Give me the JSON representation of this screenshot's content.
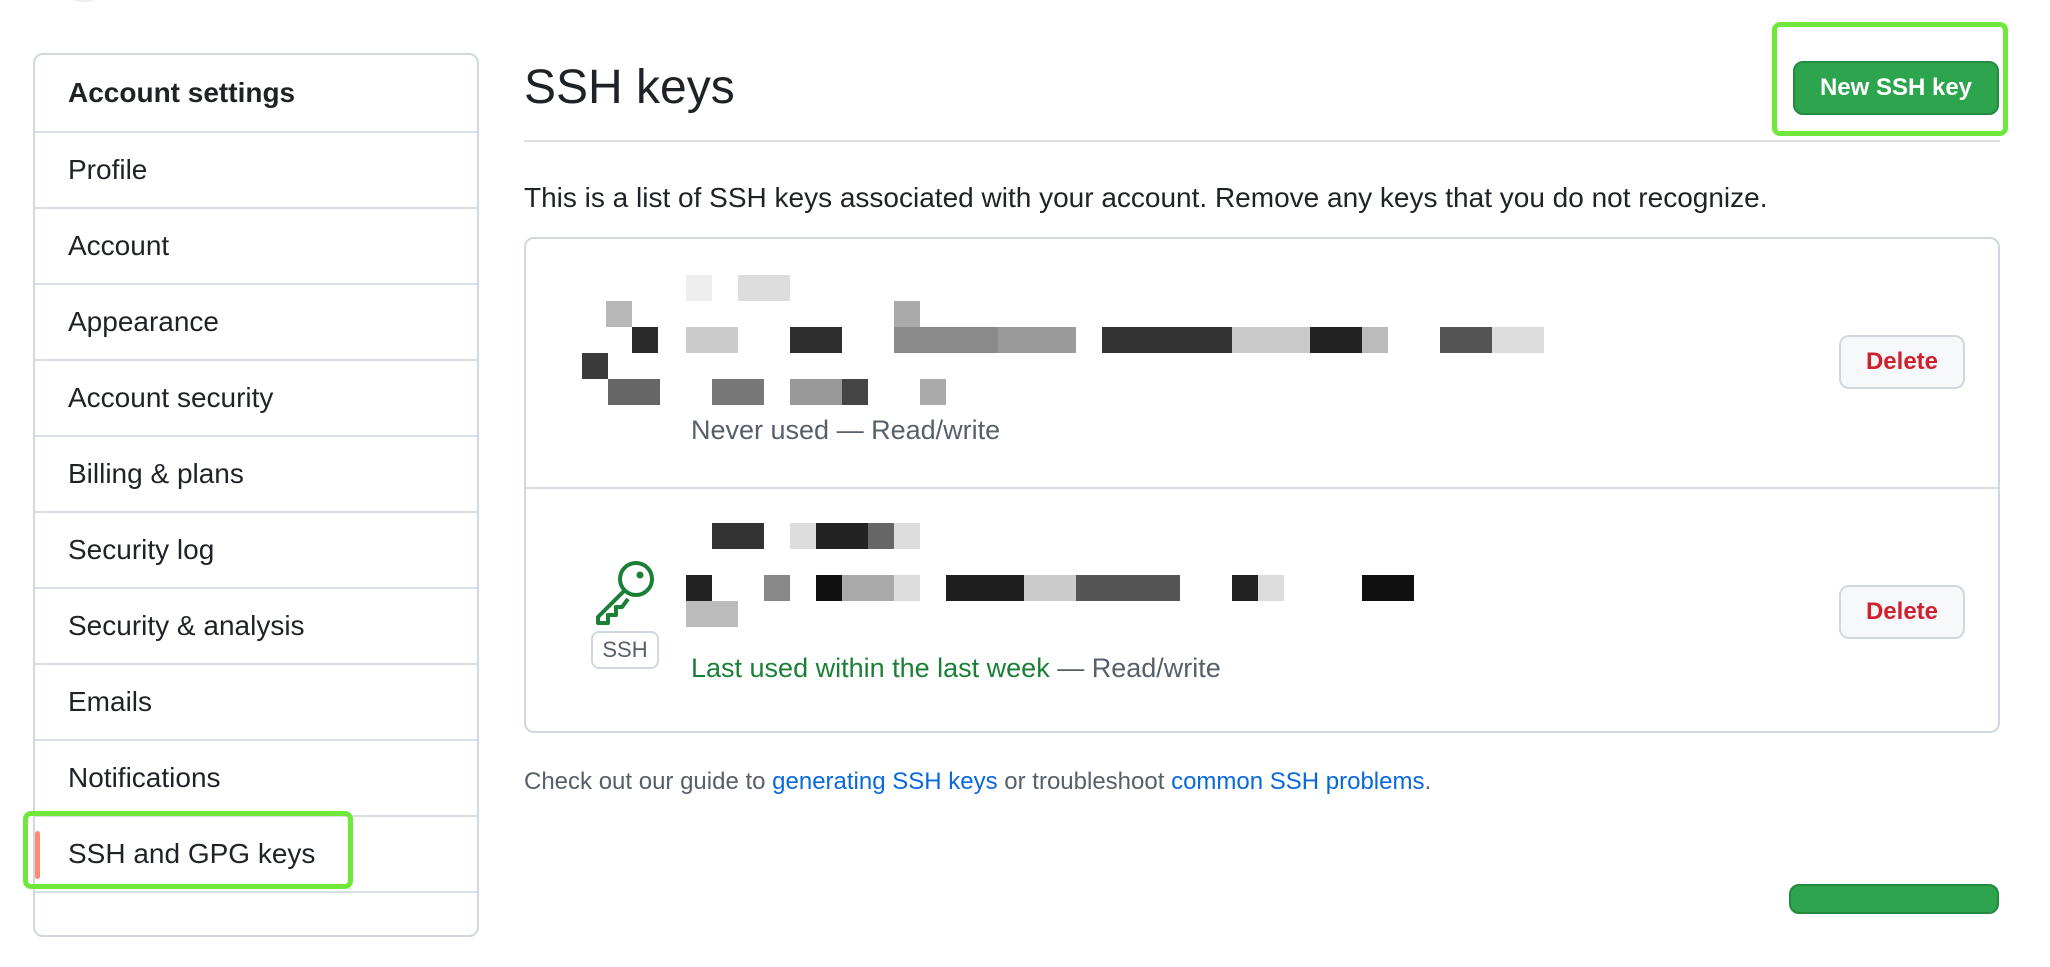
{
  "sidebar": {
    "header": "Account settings",
    "items": [
      {
        "label": "Profile"
      },
      {
        "label": "Account"
      },
      {
        "label": "Appearance"
      },
      {
        "label": "Account security"
      },
      {
        "label": "Billing & plans"
      },
      {
        "label": "Security log"
      },
      {
        "label": "Security & analysis"
      },
      {
        "label": "Emails"
      },
      {
        "label": "Notifications"
      },
      {
        "label": "SSH and GPG keys",
        "active": true
      }
    ]
  },
  "main": {
    "title": "SSH keys",
    "new_key_label": "New SSH key",
    "intro": "This is a list of SSH keys associated with your account. Remove any keys that you do not recognize.",
    "keys": [
      {
        "usage": "Never used",
        "access": "— Read/write",
        "delete_label": "Delete"
      },
      {
        "badge": "SSH",
        "usage": "Last used within the last week",
        "access": "— Read/write",
        "delete_label": "Delete"
      }
    ],
    "footer": {
      "prefix": "Check out our guide to ",
      "link1": "generating SSH keys",
      "middle": " or troubleshoot ",
      "link2": "common SSH problems",
      "suffix": "."
    }
  },
  "colors": {
    "primary_button": "#2da44e",
    "danger_text": "#cf222e",
    "link": "#0969da",
    "recent_use": "#1a7f37",
    "highlight_box": "#6fe83b",
    "active_indicator": "#fd8c73"
  },
  "icons": {
    "key": "key-icon"
  }
}
